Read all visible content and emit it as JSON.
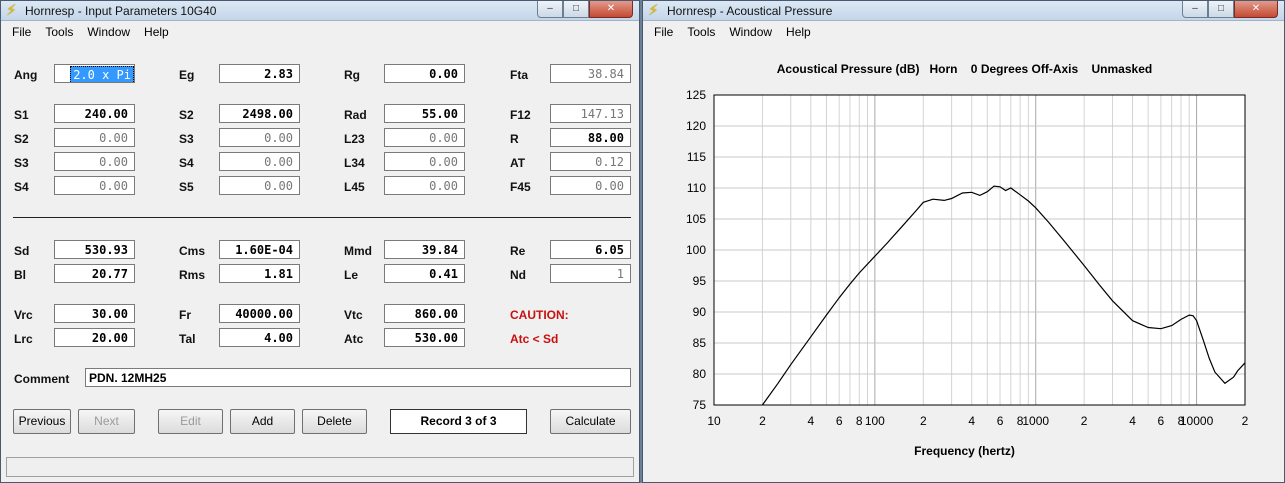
{
  "left_window": {
    "title": "Hornresp - Input Parameters   10G40",
    "menu": [
      "File",
      "Tools",
      "Window",
      "Help"
    ],
    "fields": {
      "Ang": {
        "label": "Ang",
        "value": "2.0 x Pi"
      },
      "Eg": {
        "label": "Eg",
        "value": "2.83"
      },
      "Rg": {
        "label": "Rg",
        "value": "0.00"
      },
      "Fta": {
        "label": "Fta",
        "value": "38.84"
      },
      "S1": {
        "label": "S1",
        "value": "240.00"
      },
      "S2a": {
        "label": "S2",
        "value": "2498.00"
      },
      "Rad": {
        "label": "Rad",
        "value": "55.00"
      },
      "F12": {
        "label": "F12",
        "value": "147.13"
      },
      "S2": {
        "label": "S2",
        "value": "0.00"
      },
      "S3a": {
        "label": "S3",
        "value": "0.00"
      },
      "L23": {
        "label": "L23",
        "value": "0.00"
      },
      "R": {
        "label": "R",
        "value": "88.00"
      },
      "S3": {
        "label": "S3",
        "value": "0.00"
      },
      "S4a": {
        "label": "S4",
        "value": "0.00"
      },
      "L34": {
        "label": "L34",
        "value": "0.00"
      },
      "AT": {
        "label": "AT",
        "value": "0.12"
      },
      "S4": {
        "label": "S4",
        "value": "0.00"
      },
      "S5": {
        "label": "S5",
        "value": "0.00"
      },
      "L45": {
        "label": "L45",
        "value": "0.00"
      },
      "F45": {
        "label": "F45",
        "value": "0.00"
      },
      "Sd": {
        "label": "Sd",
        "value": "530.93"
      },
      "Cms": {
        "label": "Cms",
        "value": "1.60E-04"
      },
      "Mmd": {
        "label": "Mmd",
        "value": "39.84"
      },
      "Re": {
        "label": "Re",
        "value": "6.05"
      },
      "Bl": {
        "label": "Bl",
        "value": "20.77"
      },
      "Rms": {
        "label": "Rms",
        "value": "1.81"
      },
      "Le": {
        "label": "Le",
        "value": "0.41"
      },
      "Nd": {
        "label": "Nd",
        "value": "1"
      },
      "Vrc": {
        "label": "Vrc",
        "value": "30.00"
      },
      "Fr": {
        "label": "Fr",
        "value": "40000.00"
      },
      "Vtc": {
        "label": "Vtc",
        "value": "860.00"
      },
      "Lrc": {
        "label": "Lrc",
        "value": "20.00"
      },
      "Tal": {
        "label": "Tal",
        "value": "4.00"
      },
      "Atc": {
        "label": "Atc",
        "value": "530.00"
      }
    },
    "caution_title": "CAUTION:",
    "caution_text": "Atc < Sd",
    "comment_label": "Comment",
    "comment_value": "PDN. 12MH25",
    "buttons": {
      "previous": "Previous",
      "next": "Next",
      "edit": "Edit",
      "add": "Add",
      "delete": "Delete",
      "calculate": "Calculate"
    },
    "record": "Record 3 of 3"
  },
  "right_window": {
    "title": "Hornresp - Acoustical Pressure",
    "menu": [
      "File",
      "Tools",
      "Window",
      "Help"
    ],
    "chart_header": "Acoustical Pressure (dB)   Horn    0 Degrees Off-Axis    Unmasked"
  },
  "window_controls": {
    "minimize": "–",
    "maximize": "□",
    "close": "✕"
  },
  "chart_data": {
    "type": "line",
    "title": "Acoustical Pressure (dB)   Horn    0 Degrees Off-Axis    Unmasked",
    "xlabel": "Frequency (hertz)",
    "ylabel": "",
    "x_scale": "log",
    "xlim": [
      10,
      20000
    ],
    "ylim": [
      75,
      125
    ],
    "yticks": [
      75,
      80,
      85,
      90,
      95,
      100,
      105,
      110,
      115,
      120,
      125
    ],
    "xticks": [
      {
        "value": 10,
        "label": "10"
      },
      {
        "value": 20,
        "label": "2"
      },
      {
        "value": 40,
        "label": "4"
      },
      {
        "value": 60,
        "label": "6"
      },
      {
        "value": 80,
        "label": "8"
      },
      {
        "value": 100,
        "label": "100"
      },
      {
        "value": 200,
        "label": "2"
      },
      {
        "value": 400,
        "label": "4"
      },
      {
        "value": 600,
        "label": "6"
      },
      {
        "value": 800,
        "label": "8"
      },
      {
        "value": 1000,
        "label": "1000"
      },
      {
        "value": 2000,
        "label": "2"
      },
      {
        "value": 4000,
        "label": "4"
      },
      {
        "value": 6000,
        "label": "6"
      },
      {
        "value": 8000,
        "label": "8"
      },
      {
        "value": 10000,
        "label": "10000"
      },
      {
        "value": 20000,
        "label": "2"
      }
    ],
    "grid": true,
    "series": [
      {
        "color": "#000000",
        "x": [
          20,
          25,
          30,
          40,
          50,
          60,
          70,
          80,
          100,
          120,
          150,
          180,
          200,
          230,
          270,
          300,
          350,
          400,
          450,
          500,
          550,
          600,
          650,
          700,
          800,
          900,
          1000,
          1200,
          1500,
          2000,
          2500,
          3000,
          4000,
          5000,
          6000,
          7000,
          8000,
          9000,
          9500,
          10000,
          11000,
          12000,
          13000,
          15000,
          17000,
          18000,
          20000
        ],
        "y": [
          75,
          78.5,
          81.5,
          86,
          89.5,
          92.3,
          94.5,
          96.3,
          99,
          101.2,
          104,
          106.3,
          107.7,
          108.2,
          108,
          108.3,
          109.2,
          109.3,
          108.8,
          109.4,
          110.3,
          110.2,
          109.6,
          110,
          108.9,
          107.9,
          106.8,
          104.5,
          101.5,
          97.5,
          94.3,
          91.8,
          88.6,
          87.5,
          87.3,
          87.8,
          88.8,
          89.5,
          89.4,
          88.6,
          85.5,
          82.5,
          80.3,
          78.5,
          79.5,
          80.5,
          81.8
        ]
      }
    ]
  }
}
